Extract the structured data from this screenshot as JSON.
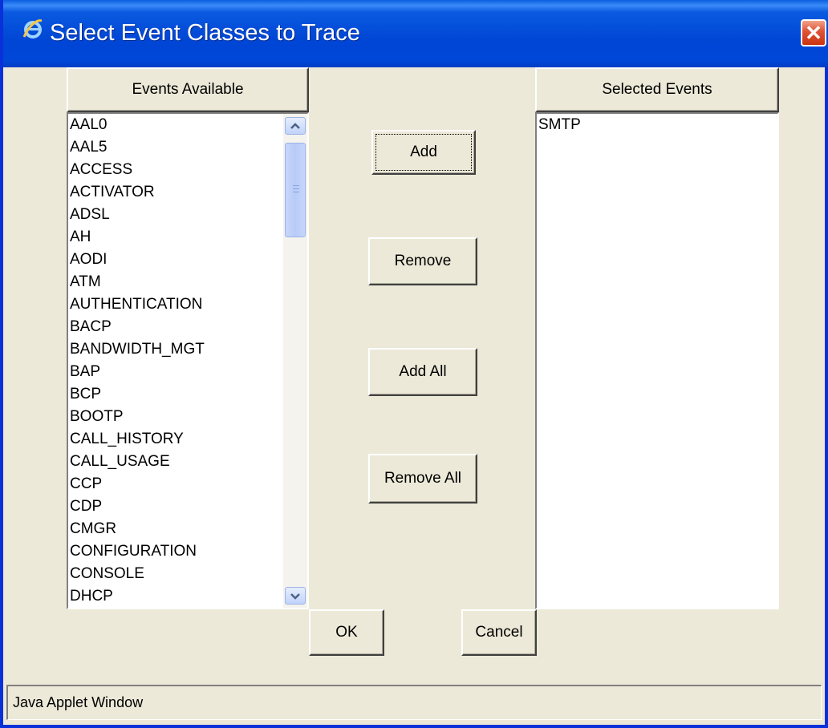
{
  "window": {
    "title": "Select Event Classes to Trace",
    "icon": "internet-explorer-icon",
    "close_icon": "close-icon",
    "title_color": "#0046d5",
    "close_color": "#e0573b",
    "body_color": "#ece9d8"
  },
  "available": {
    "header": "Events Available",
    "items": [
      "AAL0",
      "AAL5",
      "ACCESS",
      "ACTIVATOR",
      "ADSL",
      "AH",
      "AODI",
      "ATM",
      "AUTHENTICATION",
      "BACP",
      "BANDWIDTH_MGT",
      "BAP",
      "BCP",
      "BOOTP",
      "CALL_HISTORY",
      "CALL_USAGE",
      "CCP",
      "CDP",
      "CMGR",
      "CONFIGURATION",
      "CONSOLE",
      "DHCP"
    ]
  },
  "selected": {
    "header": "Selected Events",
    "items": [
      "SMTP"
    ]
  },
  "actions": {
    "add": "Add",
    "remove": "Remove",
    "add_all": "Add All",
    "remove_all": "Remove All"
  },
  "dialog": {
    "ok": "OK",
    "cancel": "Cancel"
  },
  "status": "Java Applet Window"
}
